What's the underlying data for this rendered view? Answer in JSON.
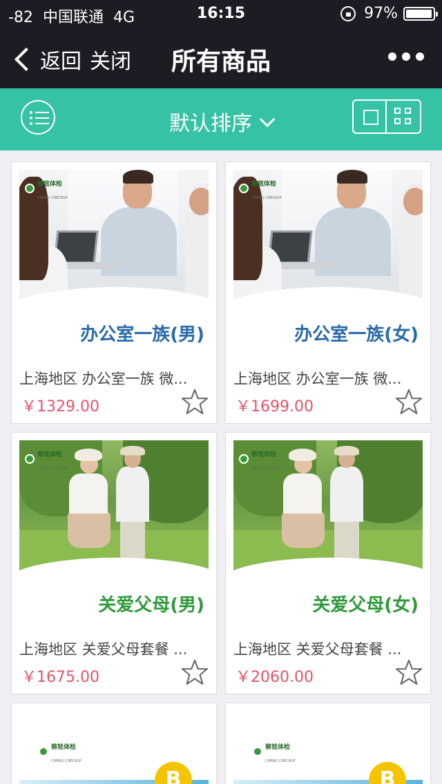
{
  "status_bar": {
    "signal": "-82",
    "carrier": "中国联通",
    "network": "4G",
    "time": "16:15",
    "battery": "97%",
    "battery_level": 0.97
  },
  "nav": {
    "back_label": "返回",
    "close_label": "关闭",
    "title": "所有商品"
  },
  "filter": {
    "sort_label": "默认排序"
  },
  "products": [
    {
      "banner": "办公室一族(男)",
      "name": "上海地区 办公室一族 微...",
      "price": "￥1329.00",
      "logo": "慈铭体检",
      "logo_sub": "CIMING CHECKUP"
    },
    {
      "banner": "办公室一族(女)",
      "name": "上海地区 办公室一族 微...",
      "price": "￥1699.00",
      "logo": "慈铭体检",
      "logo_sub": "CIMING CHECKUP"
    },
    {
      "banner": "关爱父母(男)",
      "name": "上海地区 关爱父母套餐 ...",
      "price": "￥1675.00",
      "logo": "慈铭体检",
      "logo_sub": "CIMING CHECKUP"
    },
    {
      "banner": "关爱父母(女)",
      "name": "上海地区 关爱父母套餐 ...",
      "price": "￥2060.00",
      "logo": "慈铭体检",
      "logo_sub": "CIMING CHECKUP"
    },
    {
      "logo": "慈铭体检",
      "logo_sub": "CIMING CHECKUP",
      "badge": "B"
    },
    {
      "logo": "慈铭体检",
      "logo_sub": "CIMING CHECKUP",
      "badge": "B"
    }
  ]
}
